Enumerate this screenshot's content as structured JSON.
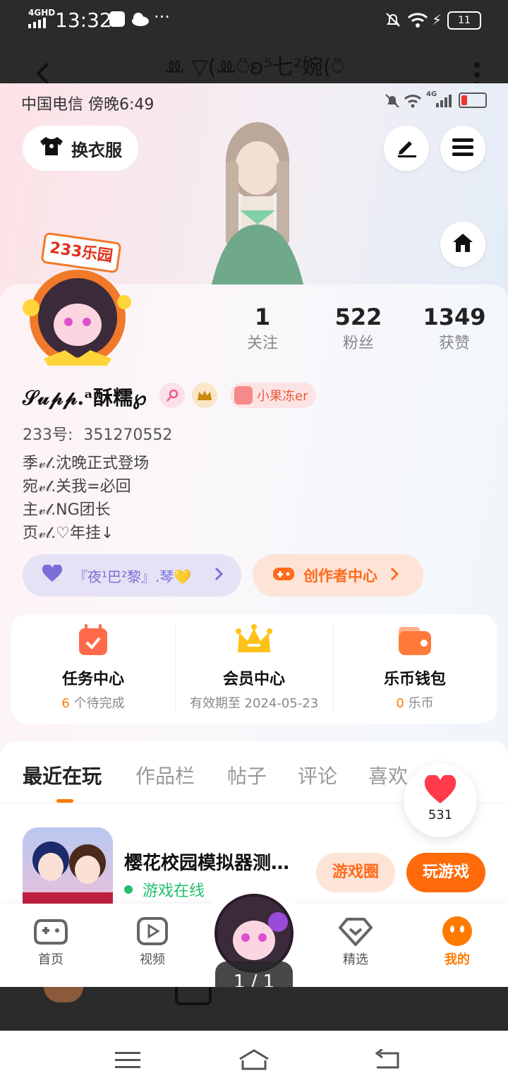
{
  "outer_status": {
    "network": "4GHD",
    "time": "13:32",
    "more": "···",
    "battery": "11"
  },
  "viewer": {
    "title": "ꔛ ▽(ꔛ⍥ʚ⁵七²婉(⍥",
    "back_icon": "chevron-left-icon",
    "menu_icon": "more-vertical-icon"
  },
  "inner_status": {
    "carrier_time": "中国电信 傍晚6:49",
    "network": "4G"
  },
  "top_actions": {
    "dress_up_label": "换衣服"
  },
  "stats": [
    {
      "value": "1",
      "label": "关注"
    },
    {
      "value": "522",
      "label": "粉丝"
    },
    {
      "value": "1349",
      "label": "获赞"
    }
  ],
  "avatar_badge": "233乐园",
  "profile": {
    "nickname": "𝒮𝓊𝓅𝓅.ᵃ酥糯℘",
    "pet_badge": "小果冻er",
    "id_label": "233号:",
    "id_value": "351270552",
    "bio": [
      "季𝓋𝓁.沈晚正式登场",
      "宛𝓋𝓁.关我=必回",
      "主𝓋𝓁.NG团长",
      "页𝓋𝓁.♡年挂↓"
    ]
  },
  "buttons": {
    "group_label": "『夜¹巴²黎』.琴💛",
    "creator_label": "创作者中心"
  },
  "services": [
    {
      "title": "任务中心",
      "count": "6",
      "sub": "个待完成",
      "color": "#ff6a4a"
    },
    {
      "title": "会员中心",
      "count": "",
      "sub": "有效期至 2024-05-23",
      "color": "#ffb300"
    },
    {
      "title": "乐币钱包",
      "count": "0",
      "sub": "乐币",
      "color": "#ff8a3a"
    }
  ],
  "tabs": [
    "最近在玩",
    "作品栏",
    "帖子",
    "评论",
    "喜欢"
  ],
  "likes": {
    "count": "531"
  },
  "game": {
    "title": "樱花校园模拟器测…",
    "status": "游戏在线",
    "circle_label": "游戏圈",
    "play_label": "玩游戏"
  },
  "nav": {
    "home": "首页",
    "video": "视频",
    "featured": "精选",
    "mine": "我的"
  },
  "page_indicator": "1 / 1",
  "colors": {
    "accent": "#ff7a00",
    "online": "#20c070",
    "purple": "#7a6ed8"
  }
}
